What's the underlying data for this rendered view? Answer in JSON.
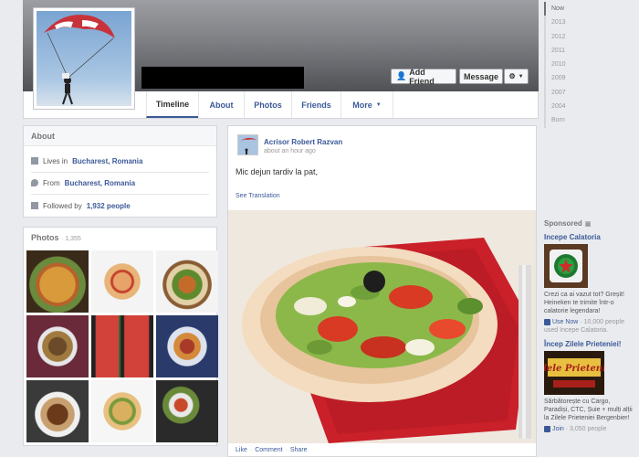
{
  "cover": {
    "add_friend_label": "Add Friend",
    "message_label": "Message"
  },
  "tabs": [
    {
      "label": "Timeline"
    },
    {
      "label": "About"
    },
    {
      "label": "Photos"
    },
    {
      "label": "Friends"
    },
    {
      "label": "More"
    }
  ],
  "years": [
    "Now",
    "2013",
    "2012",
    "2011",
    "2010",
    "2009",
    "2007",
    "2004",
    "Born"
  ],
  "about": {
    "title": "About",
    "lives_prefix": "Lives in",
    "lives_value": "Bucharest, Romania",
    "from_prefix": "From",
    "from_value": "Bucharest, Romania",
    "followed_prefix": "Followed by",
    "followed_value": "1,932 people"
  },
  "photos": {
    "title": "Photos",
    "count": "· 1,355"
  },
  "post": {
    "author": "Acrisor Robert Razvan",
    "time": "about an hour ago",
    "text": "Mic dejun tardiv la pat,",
    "see_translation": "See Translation",
    "like": "Like",
    "comment": "Comment",
    "share": "Share",
    "sep": "·"
  },
  "sponsored": {
    "title": "Sponsored",
    "ads": [
      {
        "title": "Incepe Calatoria",
        "text": "Crezi ca ai vazut tot? Greșit! Heineken te trimite într-o calatorie legendara!",
        "action": "Use Now",
        "stats": "· 10,000 people used Incepe Calatoria."
      },
      {
        "title": "Încep Zilele Prieteniei!",
        "text": "Sărbătorește cu Cargo, Paradiși, CTC, Șuie + mulți alții la Zilele Prieteniei Bergenbier!",
        "action": "Join",
        "stats": "· 3,050 people"
      }
    ]
  },
  "colors": {
    "link": "#3b5998",
    "background": "#e9ebee"
  }
}
